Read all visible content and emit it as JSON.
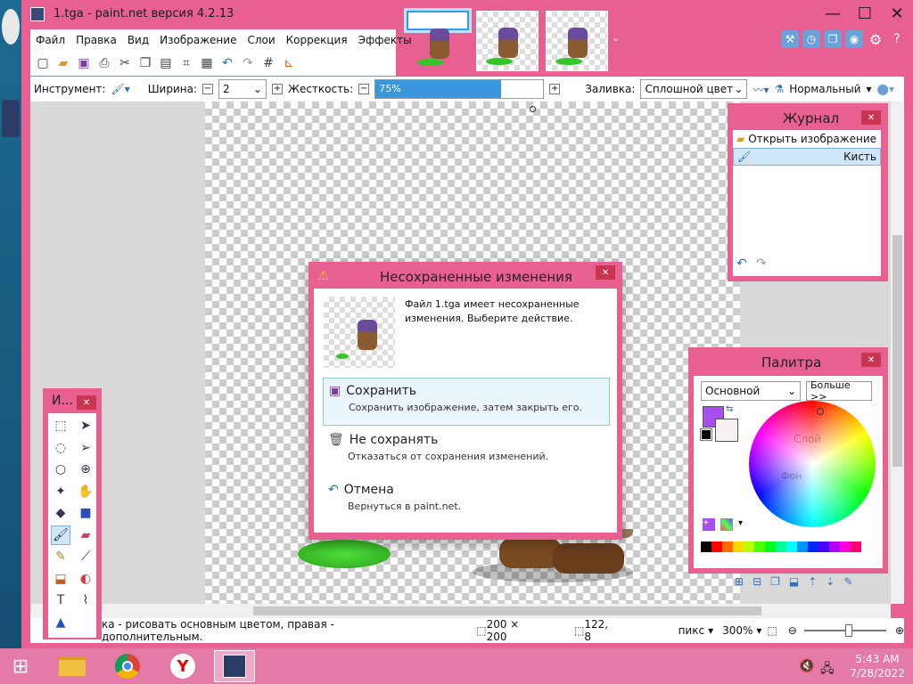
{
  "window": {
    "title": "1.tga - paint.net версия 4.2.13",
    "controls": [
      "—",
      "☐",
      "✕"
    ]
  },
  "menu": [
    "Файл",
    "Правка",
    "Вид",
    "Изображение",
    "Слои",
    "Коррекция",
    "Эффекты"
  ],
  "toolbar_options": {
    "tool_label": "Инструмент:",
    "width_label": "Ширина:",
    "width_value": "2",
    "hardness_label": "Жесткость:",
    "hardness_value": "75%",
    "hardness_fraction": 0.75,
    "fill_label": "Заливка:",
    "fill_value": "Сплошной цвет",
    "blend_value": "Нормальный"
  },
  "history": {
    "title": "Журнал",
    "items": [
      "Открыть изображение",
      "Кисть"
    ]
  },
  "palette": {
    "title": "Палитра",
    "preset": "Основной",
    "more_button": "Больше >>",
    "primary_color": "#a64ef0",
    "secondary_color": "#f9f0f4",
    "faded_labels": [
      "Слой",
      "Фон"
    ],
    "swatches": [
      "#000000",
      "#ff0000",
      "#ff6a00",
      "#ffd800",
      "#b6ff00",
      "#4cff00",
      "#00ff21",
      "#00ff90",
      "#00ffff",
      "#0094ff",
      "#0026ff",
      "#4800ff",
      "#b200ff",
      "#ff00dc",
      "#ff006e"
    ]
  },
  "dialog": {
    "title": "Несохраненные изменения",
    "message": "Файл 1.tga имеет несохраненные изменения. Выберите действие.",
    "save_title": "Сохранить",
    "save_desc": "Сохранить изображение, затем закрыть его.",
    "dontsave_title": "Не сохранять",
    "dontsave_desc": "Отказаться от сохранения изменений.",
    "cancel_title": "Отмена",
    "cancel_desc": "Вернуться в paint.net."
  },
  "tools_window": {
    "title": "И..."
  },
  "status": {
    "hint": "ка - рисовать основным цветом, правая - дополнительным.",
    "size": "200 × 200",
    "position": "122, 8",
    "unit": "пикс",
    "zoom": "300%"
  },
  "taskbar": {
    "time": "5:43 AM",
    "date": "7/28/2022"
  }
}
